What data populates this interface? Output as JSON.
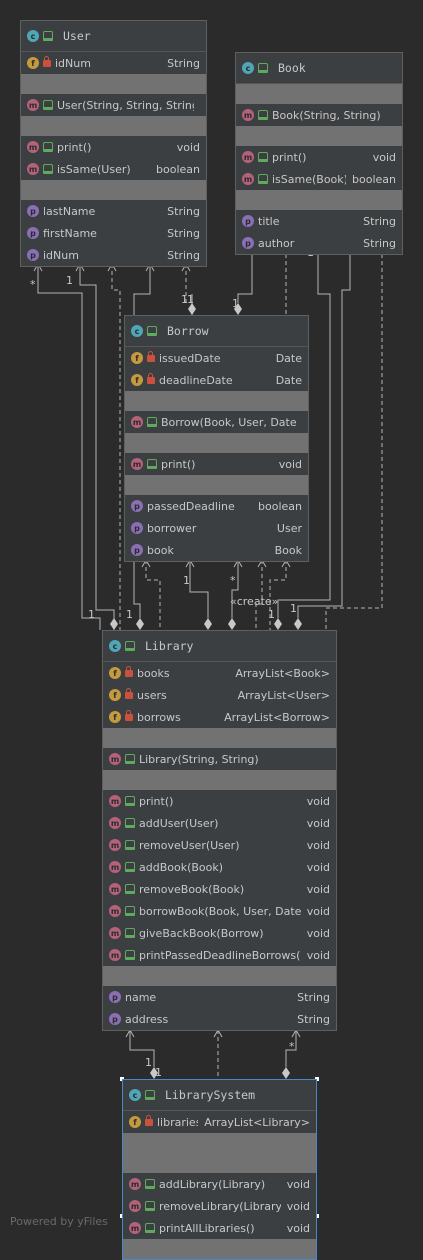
{
  "classes": {
    "user": {
      "name": "User",
      "fields": [
        {
          "icon": "f",
          "vis": "priv",
          "name": "idNum",
          "type": "String"
        }
      ],
      "ctors": [
        {
          "icon": "m",
          "vis": "pub",
          "name": "User(String, String, String)",
          "type": ""
        }
      ],
      "methods": [
        {
          "icon": "m",
          "vis": "pub",
          "name": "print()",
          "type": "void"
        },
        {
          "icon": "m",
          "vis": "pub",
          "name": "isSame(User)",
          "type": "boolean"
        }
      ],
      "props": [
        {
          "icon": "p",
          "vis": "none",
          "name": "lastName",
          "type": "String"
        },
        {
          "icon": "p",
          "vis": "none",
          "name": "firstName",
          "type": "String"
        },
        {
          "icon": "p",
          "vis": "none",
          "name": "idNum",
          "type": "String"
        }
      ]
    },
    "book": {
      "name": "Book",
      "fields": [],
      "ctors": [
        {
          "icon": "m",
          "vis": "pub",
          "name": "Book(String, String)",
          "type": ""
        }
      ],
      "methods": [
        {
          "icon": "m",
          "vis": "pub",
          "name": "print()",
          "type": "void"
        },
        {
          "icon": "m",
          "vis": "pub",
          "name": "isSame(Book)",
          "type": "boolean"
        }
      ],
      "props": [
        {
          "icon": "p",
          "vis": "none",
          "name": "title",
          "type": "String"
        },
        {
          "icon": "p",
          "vis": "none",
          "name": "author",
          "type": "String"
        }
      ]
    },
    "borrow": {
      "name": "Borrow",
      "fields": [
        {
          "icon": "f",
          "vis": "priv",
          "name": "issuedDate",
          "type": "Date"
        },
        {
          "icon": "f",
          "vis": "priv",
          "name": "deadlineDate",
          "type": "Date"
        }
      ],
      "ctors": [
        {
          "icon": "m",
          "vis": "pub",
          "name": "Borrow(Book, User, Date)",
          "type": ""
        }
      ],
      "methods": [
        {
          "icon": "m",
          "vis": "pub",
          "name": "print()",
          "type": "void"
        }
      ],
      "props": [
        {
          "icon": "p",
          "vis": "none",
          "name": "passedDeadline",
          "type": "boolean"
        },
        {
          "icon": "p",
          "vis": "none",
          "name": "borrower",
          "type": "User"
        },
        {
          "icon": "p",
          "vis": "none",
          "name": "book",
          "type": "Book"
        }
      ]
    },
    "library": {
      "name": "Library",
      "fields": [
        {
          "icon": "f",
          "vis": "priv",
          "name": "books",
          "type": "ArrayList<Book>"
        },
        {
          "icon": "f",
          "vis": "priv",
          "name": "users",
          "type": "ArrayList<User>"
        },
        {
          "icon": "f",
          "vis": "priv",
          "name": "borrows",
          "type": "ArrayList<Borrow>"
        }
      ],
      "ctors": [
        {
          "icon": "m",
          "vis": "pub",
          "name": "Library(String, String)",
          "type": ""
        }
      ],
      "methods": [
        {
          "icon": "m",
          "vis": "pub",
          "name": "print()",
          "type": "void"
        },
        {
          "icon": "m",
          "vis": "pub",
          "name": "addUser(User)",
          "type": "void"
        },
        {
          "icon": "m",
          "vis": "pub",
          "name": "removeUser(User)",
          "type": "void"
        },
        {
          "icon": "m",
          "vis": "pub",
          "name": "addBook(Book)",
          "type": "void"
        },
        {
          "icon": "m",
          "vis": "pub",
          "name": "removeBook(Book)",
          "type": "void"
        },
        {
          "icon": "m",
          "vis": "pub",
          "name": "borrowBook(Book, User, Date)",
          "type": "void"
        },
        {
          "icon": "m",
          "vis": "pub",
          "name": "giveBackBook(Borrow)",
          "type": "void"
        },
        {
          "icon": "m",
          "vis": "pub",
          "name": "printPassedDeadlineBorrows()",
          "type": "void"
        }
      ],
      "props": [
        {
          "icon": "p",
          "vis": "none",
          "name": "name",
          "type": "String"
        },
        {
          "icon": "p",
          "vis": "none",
          "name": "address",
          "type": "String"
        }
      ]
    },
    "librarysystem": {
      "name": "LibrarySystem",
      "fields": [
        {
          "icon": "f",
          "vis": "priv",
          "name": "libraries",
          "type": "ArrayList<Library>"
        }
      ],
      "ctors": [],
      "methods": [
        {
          "icon": "m",
          "vis": "pub",
          "name": "addLibrary(Library)",
          "type": "void"
        },
        {
          "icon": "m",
          "vis": "pub",
          "name": "removeLibrary(Library)",
          "type": "void"
        },
        {
          "icon": "m",
          "vis": "pub",
          "name": "printAllLibraries()",
          "type": "void"
        }
      ],
      "props": []
    }
  },
  "edge_labels": {
    "user_star": "*",
    "user_one_a": "1",
    "user_one_b": "1",
    "user_one_c": "1",
    "book_one_a": "1",
    "book_one_b": "1",
    "book_one_c": "1",
    "book_star": "*",
    "borrow_one": "1",
    "borrow_one_b": "1",
    "borrow_star": "*",
    "create": "«create»",
    "lib_one_a": "1",
    "lib_one_b": "1",
    "lib_one_c": "1",
    "lib_one_d": "1",
    "ls_one_a": "1",
    "ls_one_b": "1",
    "ls_star": "*"
  },
  "footer": "Powered by yFiles"
}
